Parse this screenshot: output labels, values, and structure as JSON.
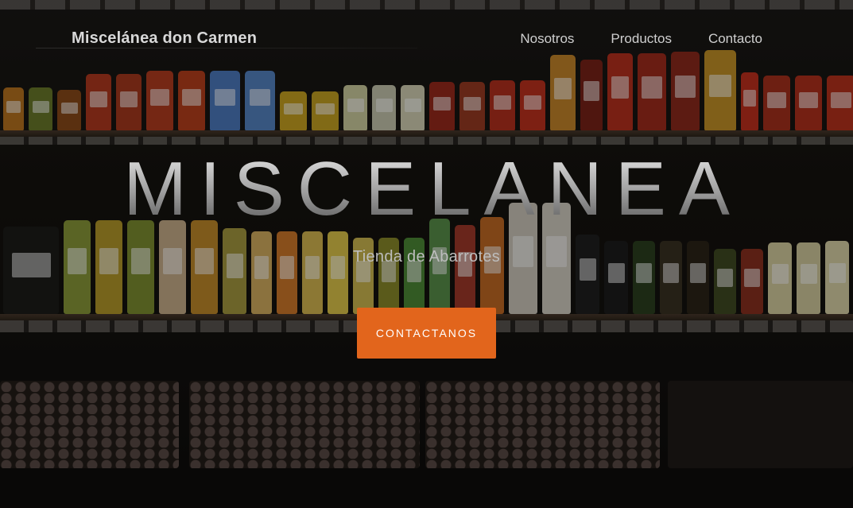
{
  "navbar": {
    "brand": "Miscelánea don Carmen",
    "links": [
      "Nosotros",
      "Productos",
      "Contacto"
    ]
  },
  "hero": {
    "title": "MISCELANEA",
    "subtitle": "Tienda de Abarrotes",
    "cta_label": "CONTACTANOS"
  },
  "colors": {
    "accent": "#e2651c",
    "background": "#141312",
    "text_light": "#d8d8d8"
  }
}
